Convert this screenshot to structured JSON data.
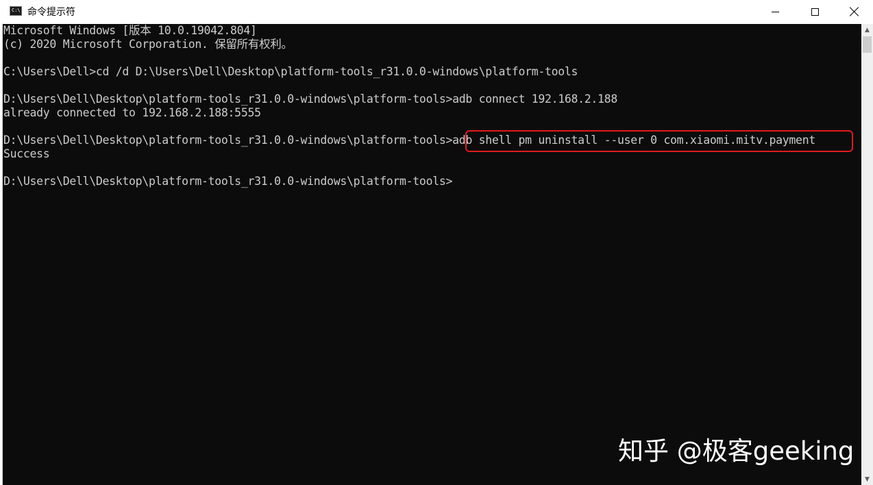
{
  "window": {
    "title": "命令提示符",
    "icon": "cmd-icon",
    "icon_label": "C:\\",
    "controls": {
      "minimize_icon": "minimize-icon",
      "maximize_icon": "maximize-icon",
      "close_icon": "close-icon"
    }
  },
  "console": {
    "background": "#0c0c0c",
    "foreground": "#cccccc",
    "lines": [
      "Microsoft Windows [版本 10.0.19042.804]",
      "(c) 2020 Microsoft Corporation. 保留所有权利。",
      "",
      "C:\\Users\\Dell>cd /d D:\\Users\\Dell\\Desktop\\platform-tools_r31.0.0-windows\\platform-tools",
      "",
      "D:\\Users\\Dell\\Desktop\\platform-tools_r31.0.0-windows\\platform-tools>adb connect 192.168.2.188",
      "already connected to 192.168.2.188:5555",
      "",
      "D:\\Users\\Dell\\Desktop\\platform-tools_r31.0.0-windows\\platform-tools>adb shell pm uninstall --user 0 com.xiaomi.mitv.payment",
      "Success",
      "",
      "D:\\Users\\Dell\\Desktop\\platform-tools_r31.0.0-windows\\platform-tools>"
    ],
    "highlight_color": "#e01b1b"
  },
  "watermark": "知乎 @极客geeking",
  "scrollbar": {
    "up_arrow": "▲",
    "down_arrow": "▼"
  }
}
